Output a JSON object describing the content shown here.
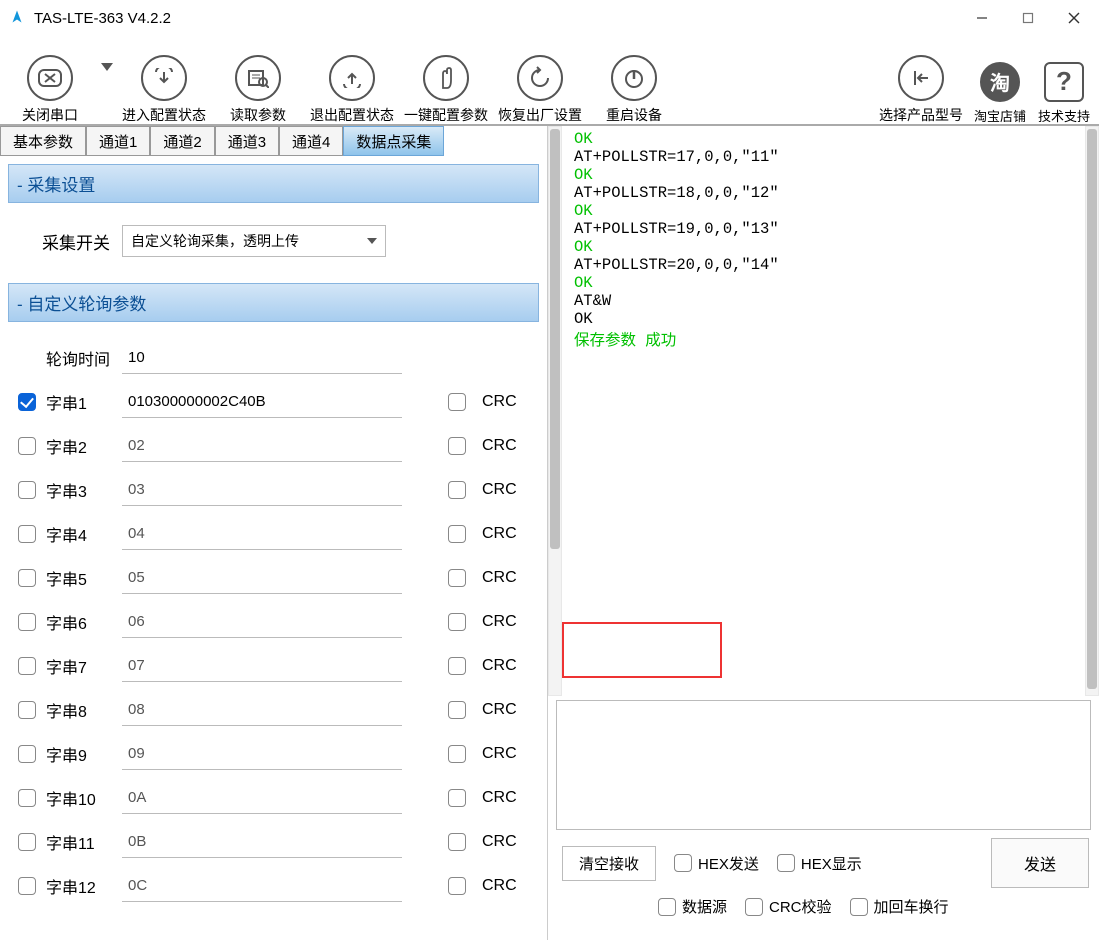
{
  "window": {
    "title": "TAS-LTE-363 V4.2.2"
  },
  "toolbar": {
    "closeSerial": "关闭串口",
    "enterConfig": "进入配置状态",
    "readParams": "读取参数",
    "exitConfig": "退出配置状态",
    "oneKeyConfig": "一键配置参数",
    "factoryReset": "恢复出厂设置",
    "reboot": "重启设备",
    "selectModel": "选择产品型号",
    "taobao": "淘宝店铺",
    "support": "技术支持"
  },
  "tabs": {
    "basic": "基本参数",
    "ch1": "通道1",
    "ch2": "通道2",
    "ch3": "通道3",
    "ch4": "通道4",
    "datapoints": "数据点采集"
  },
  "section": {
    "collect": "采集设置",
    "custom": "自定义轮询参数"
  },
  "collect": {
    "switchLabel": "采集开关",
    "switchValue": "自定义轮询采集，透明上传"
  },
  "poll": {
    "timeLabel": "轮询时间",
    "timeValue": "10",
    "crcLabel": "CRC",
    "rows": [
      {
        "checked": true,
        "label": "字串1",
        "value": "010300000002C40B"
      },
      {
        "checked": false,
        "label": "字串2",
        "value": "02"
      },
      {
        "checked": false,
        "label": "字串3",
        "value": "03"
      },
      {
        "checked": false,
        "label": "字串4",
        "value": "04"
      },
      {
        "checked": false,
        "label": "字串5",
        "value": "05"
      },
      {
        "checked": false,
        "label": "字串6",
        "value": "06"
      },
      {
        "checked": false,
        "label": "字串7",
        "value": "07"
      },
      {
        "checked": false,
        "label": "字串8",
        "value": "08"
      },
      {
        "checked": false,
        "label": "字串9",
        "value": "09"
      },
      {
        "checked": false,
        "label": "字串10",
        "value": "0A"
      },
      {
        "checked": false,
        "label": "字串11",
        "value": "0B"
      },
      {
        "checked": false,
        "label": "字串12",
        "value": "0C"
      }
    ]
  },
  "log": {
    "lines": [
      {
        "cls": "ok",
        "t": "OK"
      },
      {
        "cls": "cmd",
        "t": "AT+POLLSTR=17,0,0,\"11\""
      },
      {
        "cls": "",
        "t": ""
      },
      {
        "cls": "",
        "t": ""
      },
      {
        "cls": "ok",
        "t": "OK"
      },
      {
        "cls": "cmd",
        "t": "AT+POLLSTR=18,0,0,\"12\""
      },
      {
        "cls": "",
        "t": ""
      },
      {
        "cls": "",
        "t": ""
      },
      {
        "cls": "ok",
        "t": "OK"
      },
      {
        "cls": "cmd",
        "t": "AT+POLLSTR=19,0,0,\"13\""
      },
      {
        "cls": "",
        "t": ""
      },
      {
        "cls": "",
        "t": ""
      },
      {
        "cls": "ok",
        "t": "OK"
      },
      {
        "cls": "cmd",
        "t": "AT+POLLSTR=20,0,0,\"14\""
      },
      {
        "cls": "",
        "t": ""
      },
      {
        "cls": "",
        "t": ""
      },
      {
        "cls": "ok",
        "t": "OK"
      },
      {
        "cls": "cmd",
        "t": "AT&W"
      },
      {
        "cls": "",
        "t": ""
      },
      {
        "cls": "",
        "t": ""
      },
      {
        "cls": "cmd",
        "t": "OK"
      },
      {
        "cls": "",
        "t": ""
      },
      {
        "cls": "ok",
        "t": "保存参数 成功"
      }
    ]
  },
  "controls": {
    "clearRx": "清空接收",
    "hexSend": "HEX发送",
    "hexShow": "HEX显示",
    "dataSource": "数据源",
    "crcCheck": "CRC校验",
    "crlf": "加回车换行",
    "send": "发送"
  }
}
